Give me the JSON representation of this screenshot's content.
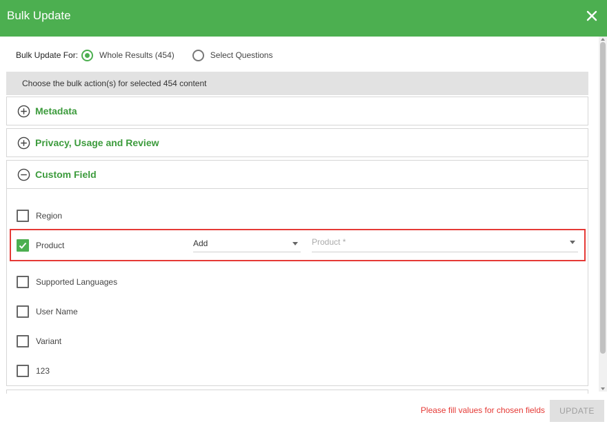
{
  "dialog": {
    "title": "Bulk Update",
    "close_icon": "close-icon"
  },
  "bulk_for": {
    "label": "Bulk Update For:",
    "options": [
      {
        "label": "Whole Results (454)",
        "selected": true
      },
      {
        "label": "Select Questions",
        "selected": false
      }
    ]
  },
  "info": "Choose the bulk action(s) for selected 454 content",
  "sections": [
    {
      "title": "Metadata",
      "expanded": false,
      "icon": "plus-circle-icon"
    },
    {
      "title": "Privacy, Usage and Review",
      "expanded": false,
      "icon": "plus-circle-icon"
    },
    {
      "title": "Custom Field",
      "expanded": true,
      "icon": "minus-circle-icon"
    }
  ],
  "custom_fields": [
    {
      "label": "Region",
      "checked": false
    },
    {
      "label": "Product",
      "checked": true,
      "action": "Add",
      "value_placeholder": "Product *"
    },
    {
      "label": "Supported Languages",
      "checked": false
    },
    {
      "label": "User Name",
      "checked": false
    },
    {
      "label": "Variant",
      "checked": false
    },
    {
      "label": "123",
      "checked": false
    }
  ],
  "footer": {
    "validation_message": "Please fill values for chosen fields",
    "update_label": "UPDATE"
  },
  "colors": {
    "accent": "#4caf50",
    "error": "#e53935",
    "section_title": "#3c9b3c"
  }
}
